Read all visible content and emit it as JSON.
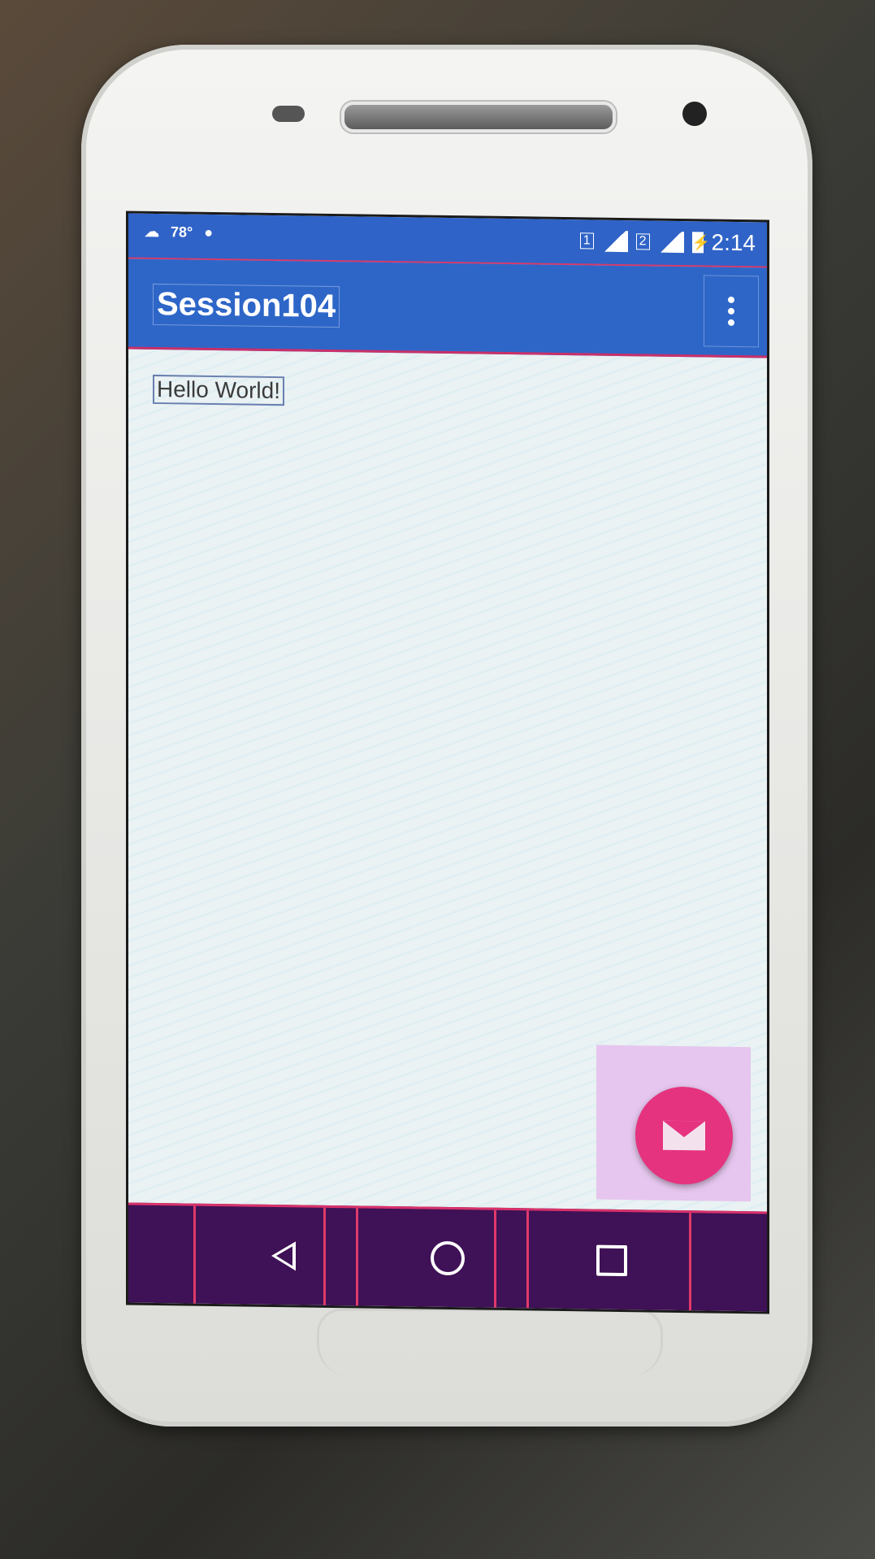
{
  "status_bar": {
    "temperature": "78°",
    "sim1": "1",
    "sim2": "2",
    "time": "2:14"
  },
  "app_bar": {
    "title": "Session104",
    "overflow_icon": "more-vert-icon"
  },
  "content": {
    "text": "Hello World!"
  },
  "fab": {
    "icon": "email-icon",
    "color": "#e5337f"
  },
  "nav_bar": {
    "back_icon": "back-icon",
    "home_icon": "home-icon",
    "recents_icon": "recents-icon"
  },
  "colors": {
    "primary": "#2e66c8",
    "accent": "#e5337f",
    "nav_background": "#3f1156"
  }
}
